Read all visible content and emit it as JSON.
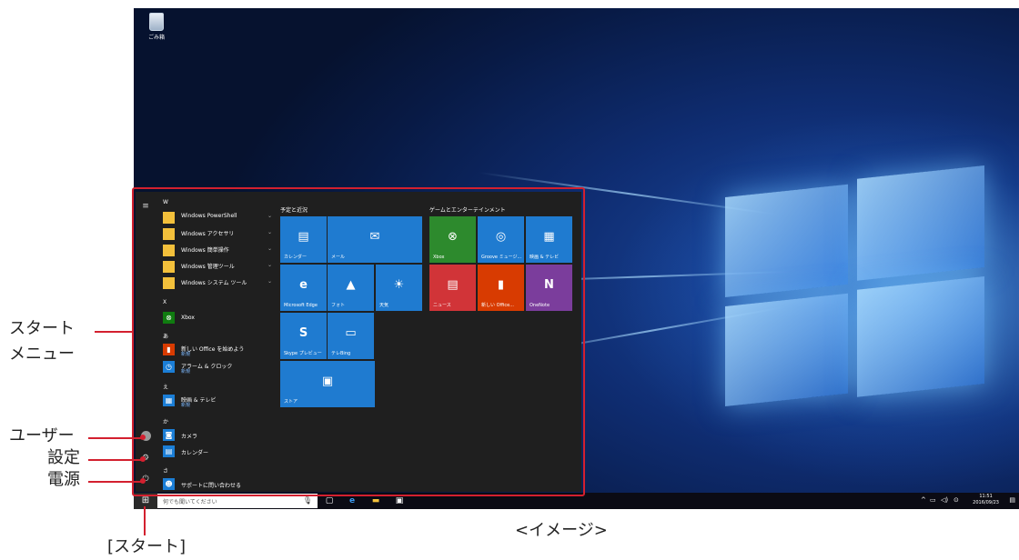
{
  "desktop": {
    "recycle_bin_label": "ごみ箱"
  },
  "start_menu": {
    "groups": {
      "w": "W",
      "x": "X",
      "a": "あ",
      "e": "え",
      "ka": "か",
      "sa": "さ"
    },
    "apps": {
      "powershell": "Windows PowerShell",
      "accessories": "Windows アクセサリ",
      "ease": "Windows 簡単操作",
      "admin": "Windows 管理ツール",
      "system": "Windows システム ツール",
      "xbox": "Xbox",
      "office_start": "新しい Office を始めよう",
      "office_start_sub": "新規",
      "alarm": "アラーム & クロック",
      "alarm_sub": "新規",
      "movies": "映画 & テレビ",
      "movies_sub": "新規",
      "camera": "カメラ",
      "calendar": "カレンダー",
      "support": "サポートに問い合わせる"
    },
    "tile_groups": {
      "schedule": "予定と近況",
      "games": "ゲームとエンターテインメント"
    },
    "tiles": {
      "calendar": "カレンダー",
      "mail": "メール",
      "edge": "Microsoft Edge",
      "photos": "フォト",
      "weather": "天気",
      "skype": "Skype プレビュー",
      "bing": "テレBing",
      "store": "ストア",
      "xbox": "Xbox",
      "groove": "Groove ミュージ...",
      "movies": "映画 & テレビ",
      "news": "ニュース",
      "office": "新しい Office...",
      "onenote": "OneNote"
    },
    "tile_colors": {
      "blue": "#1f7bd0",
      "green": "#2d8a2d",
      "red": "#d13438",
      "orange": "#d83b01",
      "purple": "#7b3d9c"
    }
  },
  "taskbar": {
    "search_placeholder": "何でも聞いてください",
    "clock_time": "11:51",
    "clock_date": "2016/09/23"
  },
  "callouts": {
    "start_menu_line1": "スタート",
    "start_menu_line2": "メニュー",
    "user": "ユーザー",
    "settings": "設定",
    "power": "電源",
    "start_button": "[スタート]",
    "image_caption": "<イメージ>"
  }
}
